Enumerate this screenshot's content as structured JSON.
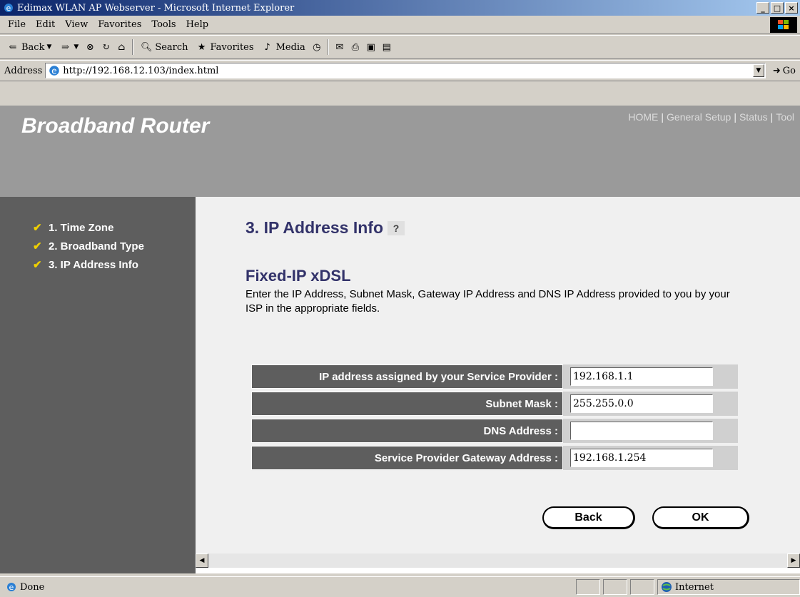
{
  "window": {
    "title": "Edimax WLAN AP Webserver - Microsoft Internet Explorer",
    "minimize": "_",
    "maximize": "□",
    "close": "×"
  },
  "menu": {
    "items": [
      "File",
      "Edit",
      "View",
      "Favorites",
      "Tools",
      "Help"
    ]
  },
  "toolbar": {
    "back": "Back",
    "search": "Search",
    "favorites": "Favorites",
    "media": "Media"
  },
  "address": {
    "label": "Address",
    "url": "http://192.168.12.103/index.html",
    "go": "Go"
  },
  "page": {
    "brand": "Broadband Router",
    "nav": [
      "HOME",
      "General Setup",
      "Status",
      "Tool"
    ],
    "sidebar": [
      "1. Time Zone",
      "2. Broadband Type",
      "3. IP Address Info"
    ],
    "title": "3. IP Address Info",
    "section": "Fixed-IP xDSL",
    "description": "Enter the IP Address, Subnet Mask, Gateway IP Address and DNS IP Address provided to you by your ISP in the appropriate fields.",
    "fields": [
      {
        "label": "IP address assigned by your Service Provider :",
        "value": "192.168.1.1"
      },
      {
        "label": "Subnet Mask :",
        "value": "255.255.0.0"
      },
      {
        "label": "DNS Address :",
        "value": ""
      },
      {
        "label": "Service Provider Gateway Address :",
        "value": "192.168.1.254"
      }
    ],
    "back_button": "Back",
    "ok_button": "OK"
  },
  "status": {
    "text": "Done",
    "zone": "Internet"
  },
  "colors": {
    "header_gray": "#9a9a9a",
    "sidebar_gray": "#5e5e5e",
    "title_navy": "#33336a"
  }
}
